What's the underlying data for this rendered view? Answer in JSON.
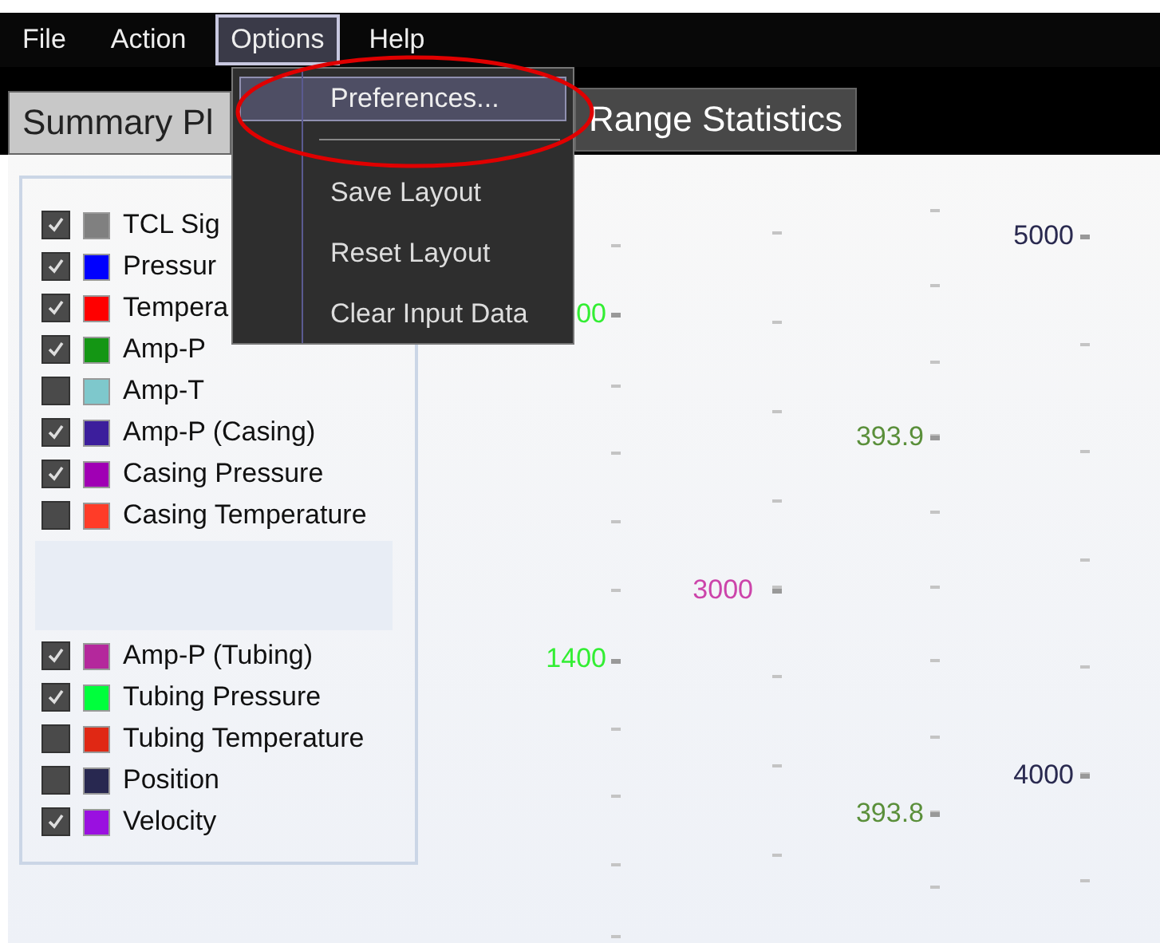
{
  "menu_bar": [
    {
      "label": "File",
      "selected": false
    },
    {
      "label": "Action",
      "selected": false
    },
    {
      "label": "Options",
      "selected": true
    },
    {
      "label": "Help",
      "selected": false
    }
  ],
  "tabs": [
    {
      "label": "Summary Pl",
      "selected": true
    },
    {
      "label": "Range Statistics",
      "selected": false
    }
  ],
  "dropdown": [
    {
      "kind": "item",
      "label": "Preferences...",
      "selected": true
    },
    {
      "kind": "separator"
    },
    {
      "kind": "item",
      "label": "Save Layout",
      "selected": false
    },
    {
      "kind": "item",
      "label": "Reset Layout",
      "selected": false
    },
    {
      "kind": "item",
      "label": "Clear Input Data",
      "selected": false
    }
  ],
  "legend": {
    "groups": [
      [
        {
          "label": "TCL Sig",
          "checked": true,
          "color": "#808080"
        },
        {
          "label": "Pressur",
          "checked": true,
          "color": "#0000ff"
        },
        {
          "label": "Tempera",
          "checked": true,
          "color": "#ff0000"
        },
        {
          "label": "Amp-P",
          "checked": true,
          "color": "#149614"
        },
        {
          "label": "Amp-T",
          "checked": false,
          "color": "#7ec8cc"
        },
        {
          "label": "Amp-P (Casing)",
          "checked": true,
          "color": "#3c1e9c"
        },
        {
          "label": "Casing Pressure",
          "checked": true,
          "color": "#a000b4"
        },
        {
          "label": "Casing Temperature",
          "checked": false,
          "color": "#ff3c28"
        }
      ],
      [
        {
          "label": "Amp-P (Tubing)",
          "checked": true,
          "color": "#b4289c"
        },
        {
          "label": "Tubing Pressure",
          "checked": true,
          "color": "#00ff3c"
        },
        {
          "label": "Tubing Temperature",
          "checked": false,
          "color": "#e02814"
        },
        {
          "label": "Position",
          "checked": false,
          "color": "#282850"
        },
        {
          "label": "Velocity",
          "checked": true,
          "color": "#9a10e0"
        }
      ]
    ]
  },
  "axis_labels": [
    {
      "text": "00",
      "color": "#33ee33"
    },
    {
      "text": "1400",
      "color": "#33ee33"
    },
    {
      "text": "3000",
      "color": "#cc44aa"
    },
    {
      "text": "393.9",
      "color": "#5a8f3a"
    },
    {
      "text": "393.8",
      "color": "#5a8f3a"
    },
    {
      "text": "5000",
      "color": "#2a2a50"
    },
    {
      "text": "4000",
      "color": "#2a2a50"
    }
  ]
}
